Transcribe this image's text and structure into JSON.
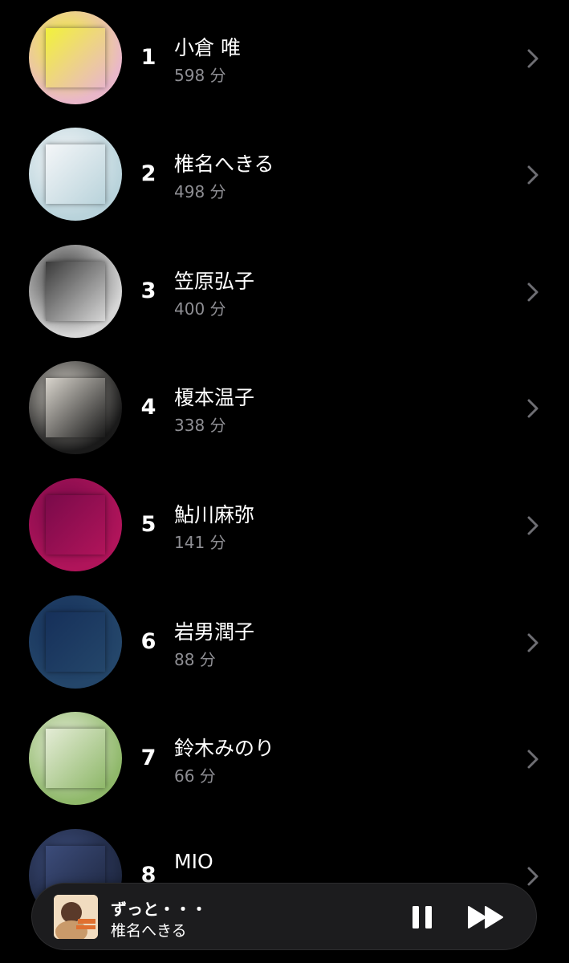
{
  "artists": [
    {
      "rank": "1",
      "name": "小倉 唯",
      "minutes": "598 分",
      "photo_bg": "#e9b7c9",
      "accent": "#f2f23a"
    },
    {
      "rank": "2",
      "name": "椎名へきる",
      "minutes": "498 分",
      "photo_bg": "#b9d3db",
      "accent": "#f4f6f8"
    },
    {
      "rank": "3",
      "name": "笠原弘子",
      "minutes": "400 分",
      "photo_bg": "#d6d6d6",
      "accent": "#3a3a3a"
    },
    {
      "rank": "4",
      "name": "榎本温子",
      "minutes": "338 分",
      "photo_bg": "#1a1a1a",
      "accent": "#d8d4cc"
    },
    {
      "rank": "5",
      "name": "鮎川麻弥",
      "minutes": "141 分",
      "photo_bg": "#b0145a",
      "accent": "#7a0a4a"
    },
    {
      "rank": "6",
      "name": "岩男潤子",
      "minutes": "88 分",
      "photo_bg": "#24466a",
      "accent": "#16305a"
    },
    {
      "rank": "7",
      "name": "鈴木みのり",
      "minutes": "66 分",
      "photo_bg": "#8fb86a",
      "accent": "#e4ecd6"
    },
    {
      "rank": "8",
      "name": "MIO",
      "minutes": "",
      "photo_bg": "#1e2740",
      "accent": "#3c4c7a"
    }
  ],
  "player": {
    "title": "ずっと・・・",
    "artist": "椎名へきる",
    "pause_icon": "pause-icon",
    "next_icon": "fast-forward-icon"
  },
  "colors": {
    "background": "#000000",
    "secondary_text": "#8e8e93",
    "chevron": "#6e6e73"
  }
}
